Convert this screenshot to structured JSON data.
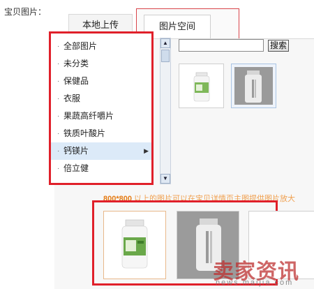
{
  "field_label": "宝贝图片：",
  "tabs": [
    {
      "label": "本地上传"
    },
    {
      "label": "图片空间"
    }
  ],
  "categories": [
    {
      "label": "全部图片",
      "selected": false
    },
    {
      "label": "未分类",
      "selected": false
    },
    {
      "label": "保健品",
      "selected": false
    },
    {
      "label": "衣服",
      "selected": false
    },
    {
      "label": "果蔬高纤嚼片",
      "selected": false
    },
    {
      "label": "铁质叶酸片",
      "selected": false
    },
    {
      "label": "钙镁片",
      "selected": true
    },
    {
      "label": "倍立健",
      "selected": false
    }
  ],
  "bullet": "·",
  "search": {
    "value": "",
    "button_label": "搜索"
  },
  "hint": {
    "size": "800*800",
    "text": " 以上的图片可以在宝贝详情页主图提供图片放大"
  },
  "watermark": {
    "title": "卖家资讯",
    "url": "news.maijia.com"
  },
  "colors": {
    "highlight_border": "#e0202a",
    "hint_orange": "#e57b14",
    "selected_bg": "#dceaf8"
  },
  "icons": {
    "scroll_up": "scroll-up-arrow-icon",
    "scroll_down": "scroll-down-arrow-icon",
    "submenu": "caret-right-icon"
  }
}
